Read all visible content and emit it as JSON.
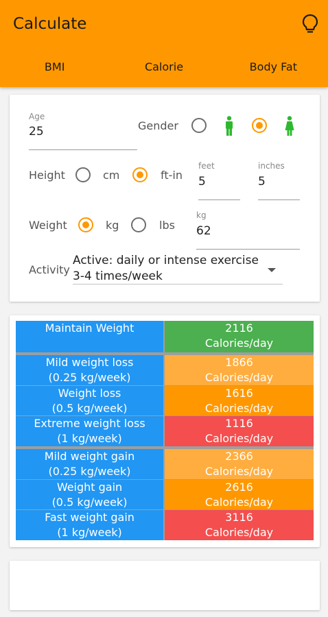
{
  "appbar": {
    "title": "Calculate",
    "bulb_icon": "lightbulb-icon"
  },
  "tabs": [
    "BMI",
    "Calorie",
    "Body Fat"
  ],
  "colors": {
    "accent": "#ff9800",
    "blue": "#2196f3",
    "green": "#4caf50",
    "light_orange": "#ffad3f",
    "orange": "#ff9800",
    "red": "#f44e4e",
    "icon_green": "#2eb82e"
  },
  "form": {
    "age": {
      "label": "Age",
      "value": "25"
    },
    "gender": {
      "label": "Gender",
      "selected": "female"
    },
    "height": {
      "label": "Height",
      "option_cm": "cm",
      "option_ftin": "ft-in",
      "selected": "ft-in",
      "feet_label": "feet",
      "feet_value": "5",
      "inches_label": "inches",
      "inches_value": "5"
    },
    "weight": {
      "label": "Weight",
      "option_kg": "kg",
      "option_lbs": "lbs",
      "selected": "kg",
      "unit_label": "kg",
      "value": "62"
    },
    "activity": {
      "label": "Activity",
      "value": "Active: daily or intense exercise 3-4 times/week"
    }
  },
  "results": [
    {
      "label": "Maintain Weight",
      "sub": "",
      "calories": "2116",
      "unit": "Calories/day",
      "color": "#4caf50"
    },
    {
      "label": "Mild weight loss",
      "sub": "(0.25 kg/week)",
      "calories": "1866",
      "unit": "Calories/day",
      "color": "#ffad3f"
    },
    {
      "label": "Weight loss",
      "sub": "(0.5 kg/week)",
      "calories": "1616",
      "unit": "Calories/day",
      "color": "#ff9800"
    },
    {
      "label": "Extreme weight loss",
      "sub": "(1 kg/week)",
      "calories": "1116",
      "unit": "Calories/day",
      "color": "#f44e4e"
    },
    {
      "label": "Mild weight gain",
      "sub": "(0.25 kg/week)",
      "calories": "2366",
      "unit": "Calories/day",
      "color": "#ffad3f"
    },
    {
      "label": "Weight gain",
      "sub": "(0.5 kg/week)",
      "calories": "2616",
      "unit": "Calories/day",
      "color": "#ff9800"
    },
    {
      "label": "Fast weight gain",
      "sub": "(1 kg/week)",
      "calories": "3116",
      "unit": "Calories/day",
      "color": "#f44e4e"
    }
  ]
}
